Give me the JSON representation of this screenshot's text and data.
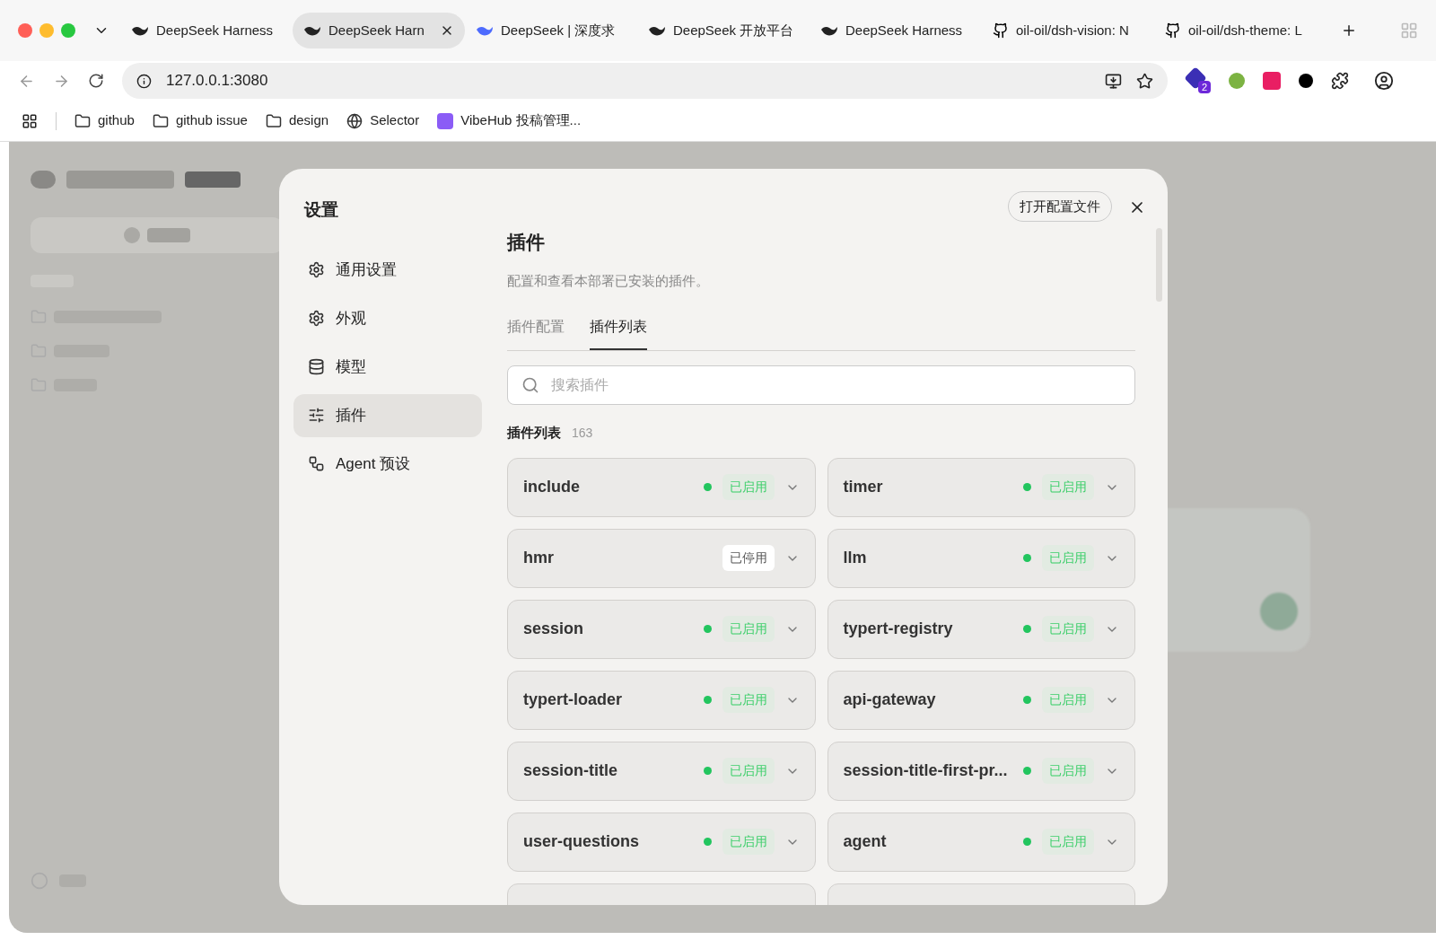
{
  "browser": {
    "tabs": [
      {
        "title": "DeepSeek Harness",
        "kind": "whale",
        "selected": false
      },
      {
        "title": "DeepSeek Harn",
        "kind": "whale",
        "selected": true
      },
      {
        "title": "DeepSeek | 深度求",
        "kind": "whale-blue",
        "selected": false
      },
      {
        "title": "DeepSeek 开放平台",
        "kind": "whale",
        "selected": false
      },
      {
        "title": "DeepSeek Harness",
        "kind": "whale",
        "selected": false
      },
      {
        "title": "oil-oil/dsh-vision: N",
        "kind": "github",
        "selected": false
      },
      {
        "title": "oil-oil/dsh-theme: L",
        "kind": "github",
        "selected": false
      }
    ],
    "address": "127.0.0.1:3080",
    "extension_badge": "2",
    "bookmarks": [
      {
        "label": "github",
        "kind": "folder"
      },
      {
        "label": "github issue",
        "kind": "folder"
      },
      {
        "label": "design",
        "kind": "folder"
      },
      {
        "label": "Selector",
        "kind": "globe"
      },
      {
        "label": "VibeHub 投稿管理...",
        "kind": "app"
      }
    ]
  },
  "modal": {
    "title": "设置",
    "open_config": "打开配置文件",
    "nav": [
      {
        "label": "通用设置",
        "kind": "gear",
        "selected": false
      },
      {
        "label": "外观",
        "kind": "gear",
        "selected": false
      },
      {
        "label": "模型",
        "kind": "database",
        "selected": false
      },
      {
        "label": "插件",
        "kind": "sliders",
        "selected": true
      },
      {
        "label": "Agent 预设",
        "kind": "nodes",
        "selected": false
      }
    ],
    "section_title": "插件",
    "description": "配置和查看本部署已安装的插件。",
    "tabs": [
      {
        "label": "插件配置",
        "selected": false
      },
      {
        "label": "插件列表",
        "selected": true
      }
    ],
    "search": {
      "placeholder": "搜索插件"
    },
    "list_label": "插件列表",
    "count": "163",
    "plugins": [
      {
        "name": "include",
        "enabled": true,
        "status": "已启用"
      },
      {
        "name": "timer",
        "enabled": true,
        "status": "已启用"
      },
      {
        "name": "hmr",
        "enabled": false,
        "status": "已停用"
      },
      {
        "name": "llm",
        "enabled": true,
        "status": "已启用"
      },
      {
        "name": "session",
        "enabled": true,
        "status": "已启用"
      },
      {
        "name": "typert-registry",
        "enabled": true,
        "status": "已启用"
      },
      {
        "name": "typert-loader",
        "enabled": true,
        "status": "已启用"
      },
      {
        "name": "api-gateway",
        "enabled": true,
        "status": "已启用"
      },
      {
        "name": "session-title",
        "enabled": true,
        "status": "已启用"
      },
      {
        "name": "session-title-first-pr...",
        "enabled": true,
        "status": "已启用"
      },
      {
        "name": "user-questions",
        "enabled": true,
        "status": "已启用"
      },
      {
        "name": "agent",
        "enabled": true,
        "status": "已启用"
      }
    ]
  }
}
